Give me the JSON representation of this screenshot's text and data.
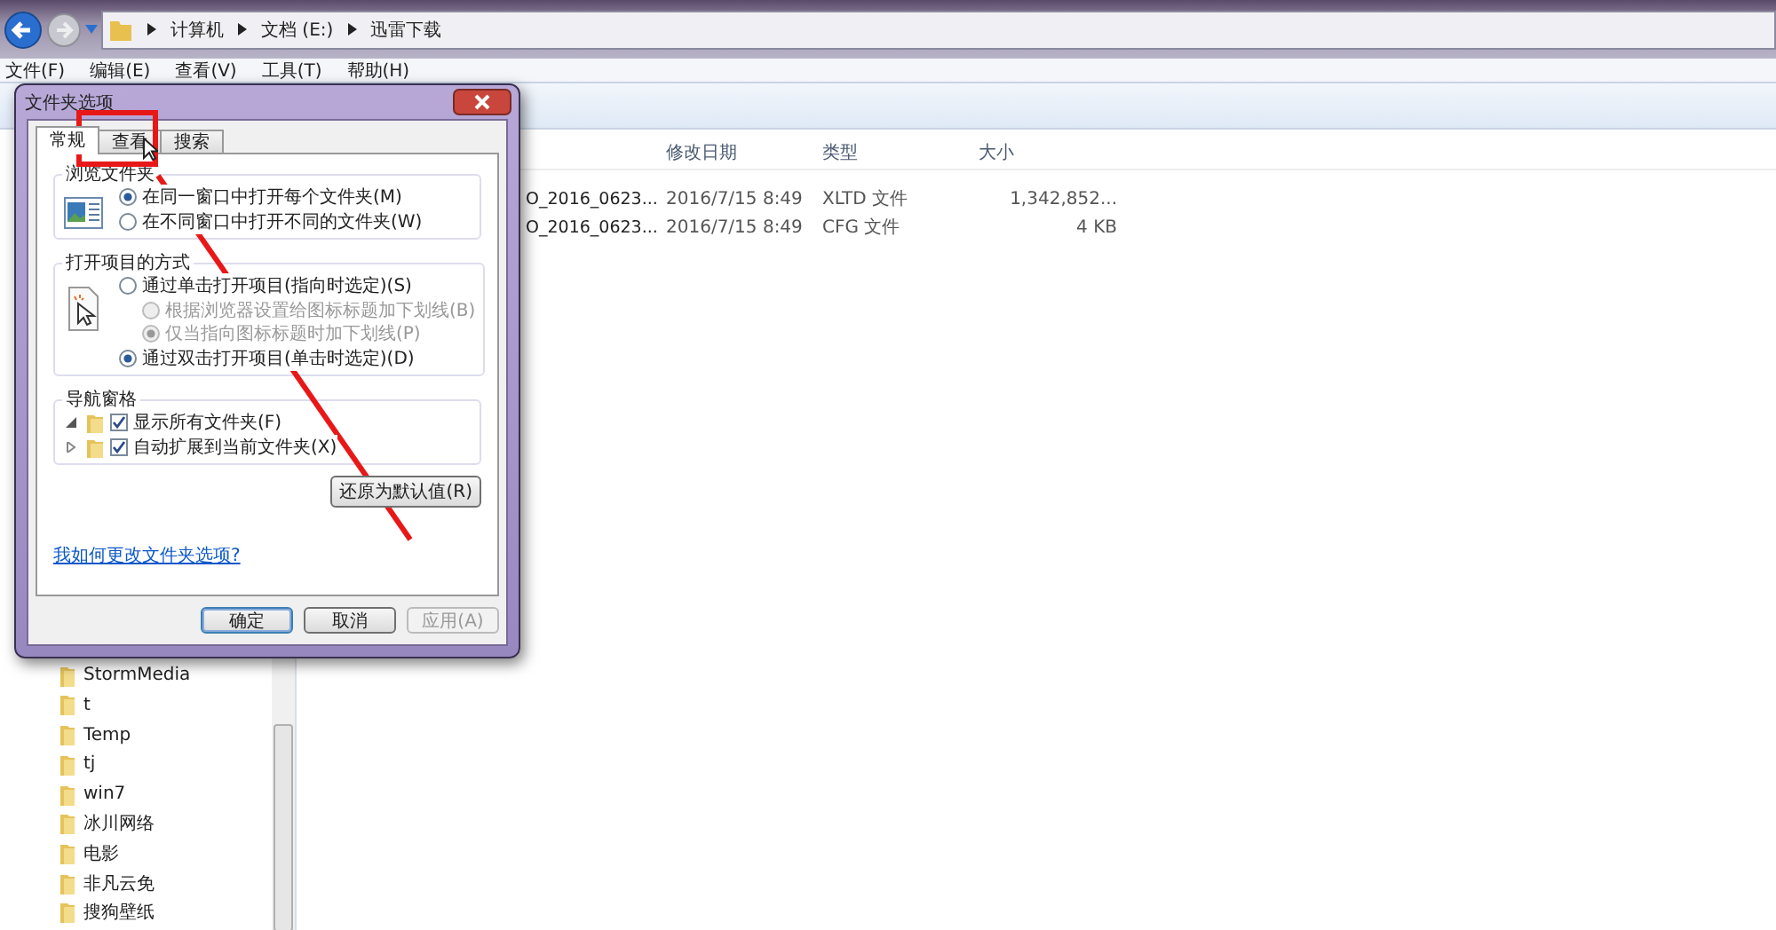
{
  "address_bar": {
    "path": [
      "计算机",
      "文档 (E:)",
      "迅雷下载"
    ]
  },
  "menu_bar": [
    "文件(F)",
    "编辑(E)",
    "查看(V)",
    "工具(T)",
    "帮助(H)"
  ],
  "nav_tree": {
    "items": [
      "StormMedia",
      "t",
      "Temp",
      "tj",
      "win7",
      "冰川网络",
      "电影",
      "非凡云免",
      "搜狗壁纸"
    ]
  },
  "file_list": {
    "columns": [
      "修改日期",
      "类型",
      "大小"
    ],
    "rows": [
      {
        "name": "O_2016_0623...",
        "modified": "2016/7/15 8:49",
        "type": "XLTD 文件",
        "size": "1,342,852..."
      },
      {
        "name": "O_2016_0623...",
        "modified": "2016/7/15 8:49",
        "type": "CFG 文件",
        "size": "4 KB"
      }
    ]
  },
  "dialog": {
    "title": "文件夹选项",
    "tabs": [
      {
        "label": "常规",
        "selected": true
      },
      {
        "label": "查看",
        "selected": false
      },
      {
        "label": "搜索",
        "selected": false
      }
    ],
    "groups": [
      {
        "title": "浏览文件夹",
        "kind": "window",
        "options": [
          {
            "kind": "radio",
            "label": "在同一窗口中打开每个文件夹(M)",
            "selected": true,
            "disabled": false
          },
          {
            "kind": "radio",
            "label": "在不同窗口中打开不同的文件夹(W)",
            "selected": false,
            "disabled": false
          }
        ]
      },
      {
        "title": "打开项目的方式",
        "kind": "click",
        "options": [
          {
            "kind": "radio",
            "label": "通过单击打开项目(指向时选定)(S)",
            "selected": false,
            "disabled": false,
            "children": [
              {
                "kind": "radio",
                "label": "根据浏览器设置给图标标题加下划线(B)",
                "selected": false,
                "disabled": true
              },
              {
                "kind": "radio",
                "label": "仅当指向图标标题时加下划线(P)",
                "selected": true,
                "disabled": true
              }
            ]
          },
          {
            "kind": "radio",
            "label": "通过双击打开项目(单击时选定)(D)",
            "selected": true,
            "disabled": false
          }
        ]
      },
      {
        "title": "导航窗格",
        "kind": "tree",
        "options": [
          {
            "kind": "checkbox",
            "label": "显示所有文件夹(F)",
            "checked": true,
            "disabled": false,
            "expanded": true
          },
          {
            "kind": "checkbox",
            "label": "自动扩展到当前文件夹(X)",
            "checked": true,
            "disabled": false,
            "expanded": false
          }
        ]
      }
    ],
    "reset_button": "还原为默认值(R)",
    "help_link": "我如何更改文件夹选项?",
    "buttons": [
      {
        "label": "确定",
        "default": true,
        "disabled": false
      },
      {
        "label": "取消",
        "default": false,
        "disabled": false
      },
      {
        "label": "应用(A)",
        "default": false,
        "disabled": true
      }
    ]
  }
}
